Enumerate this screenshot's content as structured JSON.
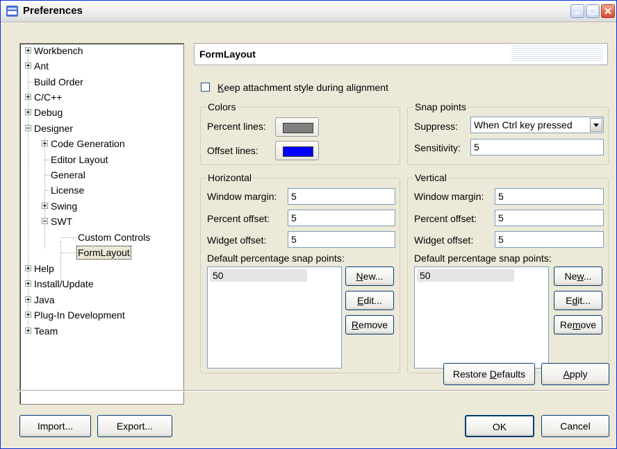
{
  "window": {
    "title": "Preferences"
  },
  "tree": {
    "items": [
      {
        "label": "Workbench"
      },
      {
        "label": "Ant"
      },
      {
        "label": "Build Order"
      },
      {
        "label": "C/C++"
      },
      {
        "label": "Debug"
      },
      {
        "label": "Designer"
      },
      {
        "label": "Code Generation"
      },
      {
        "label": "Editor Layout"
      },
      {
        "label": "General"
      },
      {
        "label": "License"
      },
      {
        "label": "Swing"
      },
      {
        "label": "SWT"
      },
      {
        "label": "Custom Controls"
      },
      {
        "label": "FormLayout"
      },
      {
        "label": "Help"
      },
      {
        "label": "Install/Update"
      },
      {
        "label": "Java"
      },
      {
        "label": "Plug-In Development"
      },
      {
        "label": "Team"
      }
    ],
    "selected": "FormLayout"
  },
  "page": {
    "title": "FormLayout",
    "keep_style": {
      "pre": "",
      "key": "K",
      "post": "eep attachment style during alignment",
      "checked": false
    },
    "colors": {
      "title": "Colors",
      "percent_label": "Percent lines:",
      "percent_color": "#808080",
      "offset_label": "Offset lines:",
      "offset_color": "#0000ff"
    },
    "snap": {
      "title": "Snap points",
      "suppress_label": "Suppress:",
      "suppress_value": "When Ctrl key pressed",
      "sensitivity_label": "Sensitivity:",
      "sensitivity_value": "5"
    },
    "horizontal": {
      "title": "Horizontal",
      "window_margin_label": "Window margin:",
      "window_margin": "5",
      "percent_offset_label": "Percent offset:",
      "percent_offset": "5",
      "widget_offset_label": "Widget offset:",
      "widget_offset": "5",
      "snap_label": "Default percentage snap points:",
      "snap_points": [
        "50"
      ],
      "new": {
        "pre": "",
        "key": "N",
        "post": "ew..."
      },
      "edit": {
        "pre": "",
        "key": "E",
        "post": "dit..."
      },
      "remove": {
        "pre": "",
        "key": "R",
        "post": "emove"
      }
    },
    "vertical": {
      "title": "Vertical",
      "window_margin_label": "Window margin:",
      "window_margin": "5",
      "percent_offset_label": "Percent offset:",
      "percent_offset": "5",
      "widget_offset_label": "Widget offset:",
      "widget_offset": "5",
      "snap_label": "Default percentage snap points:",
      "snap_points": [
        "50"
      ],
      "new": {
        "pre": "Ne",
        "key": "w",
        "post": "..."
      },
      "edit": {
        "pre": "E",
        "key": "d",
        "post": "it..."
      },
      "remove": {
        "pre": "Re",
        "key": "m",
        "post": "ove"
      }
    },
    "restore_defaults": {
      "pre": "Restore ",
      "key": "D",
      "post": "efaults"
    },
    "apply": {
      "pre": "",
      "key": "A",
      "post": "pply"
    }
  },
  "footer": {
    "import": "Import...",
    "export": "Export...",
    "ok": "OK",
    "cancel": "Cancel"
  }
}
